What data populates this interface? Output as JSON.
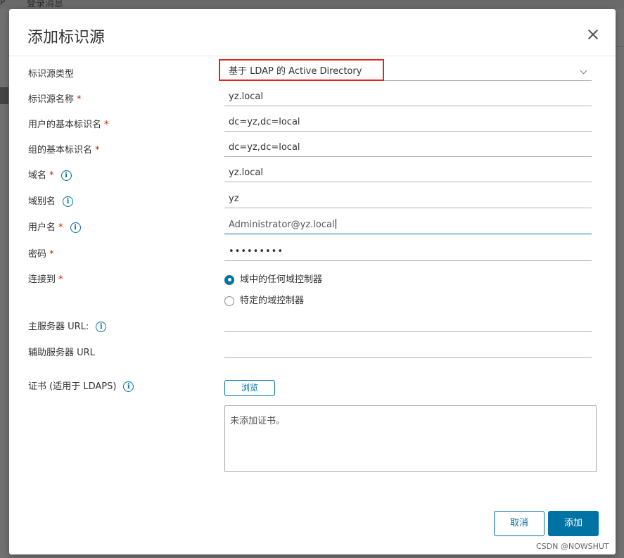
{
  "background": {
    "tab_label": "登录消息",
    "corner_mark": "P"
  },
  "dialog": {
    "title": "添加标识源",
    "close_icon": "close-icon"
  },
  "form": {
    "source_type": {
      "label": "标识源类型",
      "value": "基于 LDAP 的 Active Directory"
    },
    "source_name": {
      "label": "标识源名称",
      "required": "*",
      "value": "yz.local"
    },
    "user_base_dn": {
      "label": "用户的基本标识名",
      "required": "*",
      "value": "dc=yz,dc=local"
    },
    "group_base_dn": {
      "label": "组的基本标识名",
      "required": "*",
      "value": "dc=yz,dc=local"
    },
    "domain_name": {
      "label": "域名",
      "required": "*",
      "value": "yz.local"
    },
    "domain_alias": {
      "label": "域别名",
      "value": "yz"
    },
    "username": {
      "label": "用户名",
      "required": "*",
      "value": "Administrator@yz.local"
    },
    "password": {
      "label": "密码",
      "required": "*",
      "value": "•••••••••"
    },
    "connect_to": {
      "label": "连接到",
      "required": "*",
      "options": [
        "域中的任何域控制器",
        "特定的域控制器"
      ],
      "selected": "域中的任何域控制器"
    },
    "primary_server_url": {
      "label": "主服务器 URL:",
      "value": ""
    },
    "secondary_server_url": {
      "label": "辅助服务器 URL",
      "value": ""
    },
    "certificates": {
      "label": "证书 (适用于 LDAPS)",
      "browse_label": "浏览",
      "empty_text": "未添加证书。"
    },
    "info_glyph": "i"
  },
  "footer": {
    "cancel_label": "取消",
    "add_label": "添加"
  },
  "watermark": "CSDN @NOWSHUT",
  "colors": {
    "accent": "#0072a3",
    "required": "#c92100",
    "highlight": "#e0261d"
  }
}
